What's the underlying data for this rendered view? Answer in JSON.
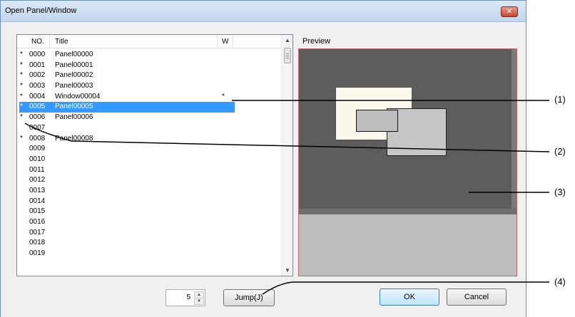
{
  "window": {
    "title": "Open Panel/Window",
    "close_glyph": "✕"
  },
  "list": {
    "columns": {
      "no": "NO.",
      "title": "Title",
      "w": "W"
    },
    "rows": [
      {
        "mark": "*",
        "no": "0000",
        "title": "Panel00000",
        "w": ""
      },
      {
        "mark": "*",
        "no": "0001",
        "title": "Panel00001",
        "w": ""
      },
      {
        "mark": "*",
        "no": "0002",
        "title": "Panel00002",
        "w": ""
      },
      {
        "mark": "*",
        "no": "0003",
        "title": "Panel00003",
        "w": ""
      },
      {
        "mark": "*",
        "no": "0004",
        "title": "Window00004",
        "w": "*"
      },
      {
        "mark": "*",
        "no": "0005",
        "title": "Panel00005",
        "w": "",
        "selected": true
      },
      {
        "mark": "*",
        "no": "0006",
        "title": "Panel00006",
        "w": ""
      },
      {
        "mark": "",
        "no": "0007",
        "title": "",
        "w": ""
      },
      {
        "mark": "*",
        "no": "0008",
        "title": "Panel00008",
        "w": ""
      },
      {
        "mark": "",
        "no": "0009",
        "title": "",
        "w": ""
      },
      {
        "mark": "",
        "no": "0010",
        "title": "",
        "w": ""
      },
      {
        "mark": "",
        "no": "0011",
        "title": "",
        "w": ""
      },
      {
        "mark": "",
        "no": "0012",
        "title": "",
        "w": ""
      },
      {
        "mark": "",
        "no": "0013",
        "title": "",
        "w": ""
      },
      {
        "mark": "",
        "no": "0014",
        "title": "",
        "w": ""
      },
      {
        "mark": "",
        "no": "0015",
        "title": "",
        "w": ""
      },
      {
        "mark": "",
        "no": "0016",
        "title": "",
        "w": ""
      },
      {
        "mark": "",
        "no": "0017",
        "title": "",
        "w": ""
      },
      {
        "mark": "",
        "no": "0018",
        "title": "",
        "w": ""
      },
      {
        "mark": "",
        "no": "0019",
        "title": "",
        "w": ""
      }
    ]
  },
  "preview": {
    "label": "Preview"
  },
  "jump_number": "5",
  "buttons": {
    "jump": "Jump(J)",
    "ok": "OK",
    "cancel": "Cancel"
  },
  "callouts": [
    "(1)",
    "(2)",
    "(3)",
    "(4)"
  ],
  "colors": {
    "selection": "#3399ff",
    "preview_canvas": "#5d5d5d",
    "preview_border": "#b86a6a"
  }
}
